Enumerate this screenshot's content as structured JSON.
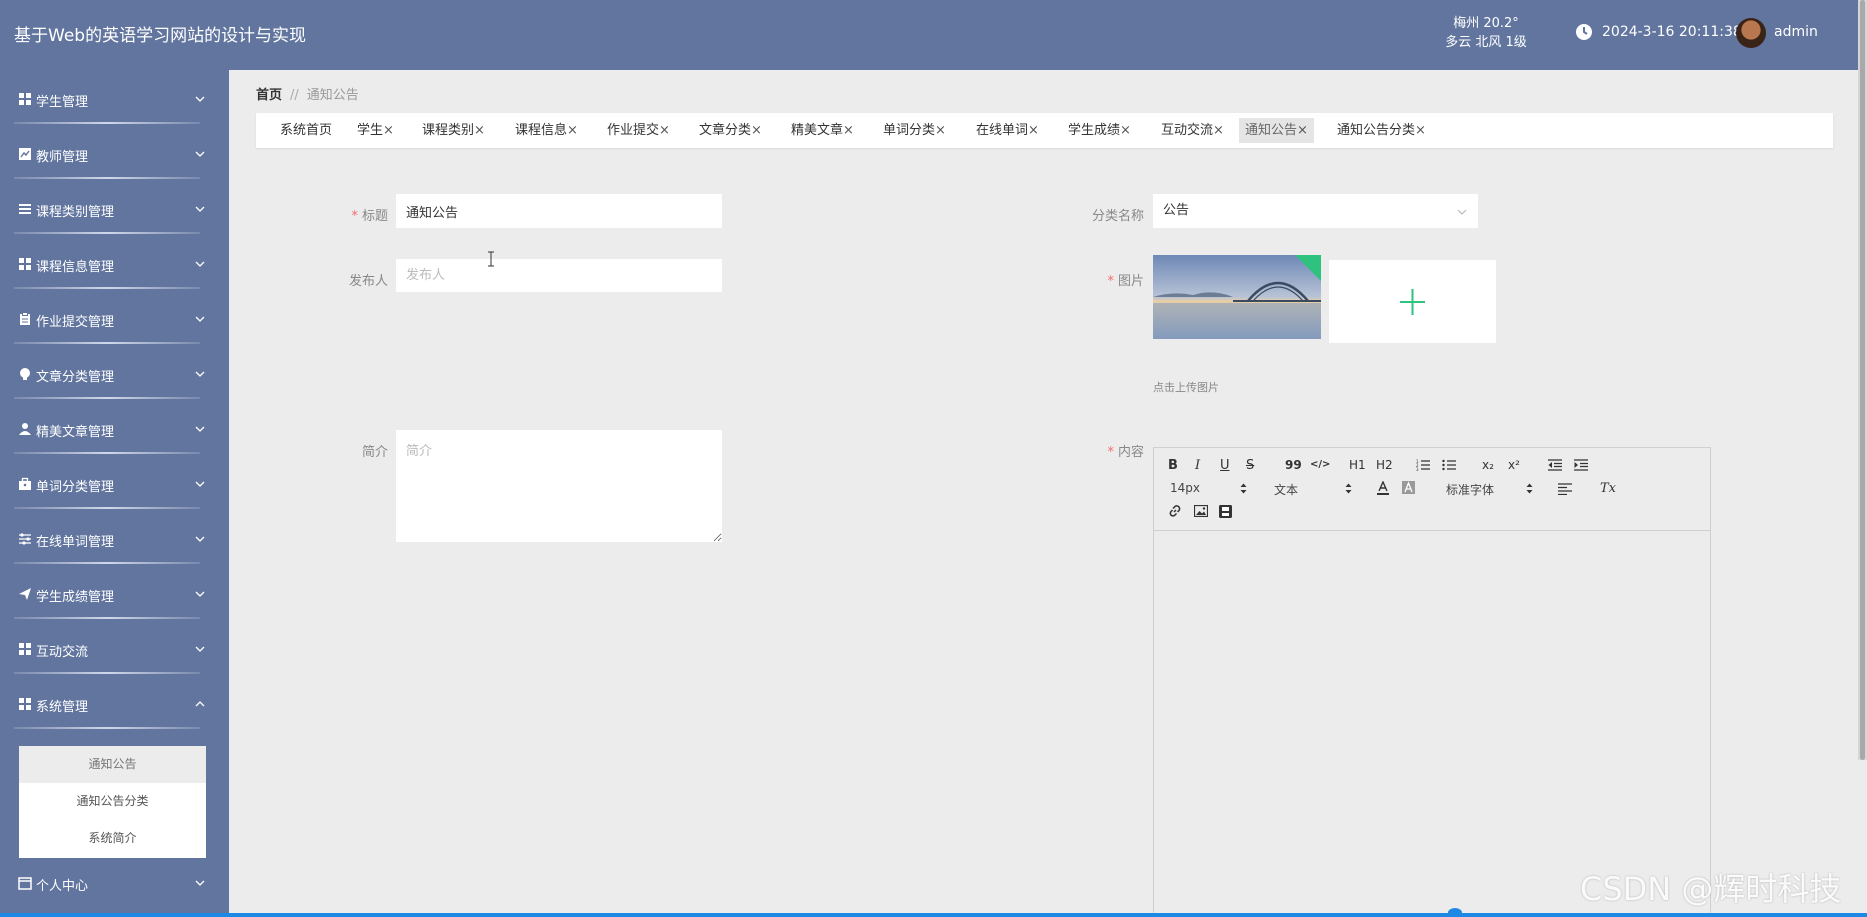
{
  "header": {
    "app_title": "基于Web的英语学习网站的设计与实现",
    "weather_line1": "梅州  20.2°",
    "weather_line2": "多云  北风  1级",
    "datetime": "2024-3-16 20:11:38",
    "username": "admin"
  },
  "sidebar": {
    "items": [
      {
        "label": "学生管理",
        "icon": "grid-icon"
      },
      {
        "label": "教师管理",
        "icon": "chart-icon"
      },
      {
        "label": "课程类别管理",
        "icon": "list-icon"
      },
      {
        "label": "课程信息管理",
        "icon": "grid-icon"
      },
      {
        "label": "作业提交管理",
        "icon": "clipboard-icon"
      },
      {
        "label": "文章分类管理",
        "icon": "bulb-icon"
      },
      {
        "label": "精美文章管理",
        "icon": "user-icon"
      },
      {
        "label": "单词分类管理",
        "icon": "briefcase-icon"
      },
      {
        "label": "在线单词管理",
        "icon": "sliders-icon"
      },
      {
        "label": "学生成绩管理",
        "icon": "send-icon"
      },
      {
        "label": "互动交流",
        "icon": "grid-icon"
      },
      {
        "label": "系统管理",
        "icon": "grid-icon"
      }
    ],
    "system_submenu": [
      "通知公告",
      "通知公告分类",
      "系统简介"
    ],
    "personal_center": "个人中心"
  },
  "breadcrumb": {
    "home": "首页",
    "separator": "//",
    "current": "通知公告"
  },
  "tabs": [
    "系统首页",
    "学生",
    "课程类别",
    "课程信息",
    "作业提交",
    "文章分类",
    "精美文章",
    "单词分类",
    "在线单词",
    "学生成绩",
    "互动交流",
    "通知公告",
    "通知公告分类"
  ],
  "close_glyph": "×",
  "form": {
    "title_label": "标题",
    "title_value": "通知公告",
    "category_label": "分类名称",
    "category_value": "公告",
    "publisher_label": "发布人",
    "publisher_placeholder": "发布人",
    "image_label": "图片",
    "upload_tip": "点击上传图片",
    "intro_label": "简介",
    "intro_placeholder": "简介",
    "content_label": "内容",
    "required_mark": "*"
  },
  "editor": {
    "font_size": "14px",
    "text_format": "文本",
    "font_family": "标准字体",
    "buttons": {
      "bold": "B",
      "italic": "I",
      "underline": "U",
      "strike": "S",
      "quote": "99",
      "code": "</>",
      "h1": "H1",
      "h2": "H2",
      "subscript": "x₂",
      "superscript": "x²",
      "clear": "Tx"
    }
  },
  "watermark": "CSDN @辉时科技",
  "colors": {
    "sidebar_bg": "#61759f",
    "accent": "#1e88e5",
    "upload_plus": "#2ec27e",
    "required": "#f56c6c"
  }
}
